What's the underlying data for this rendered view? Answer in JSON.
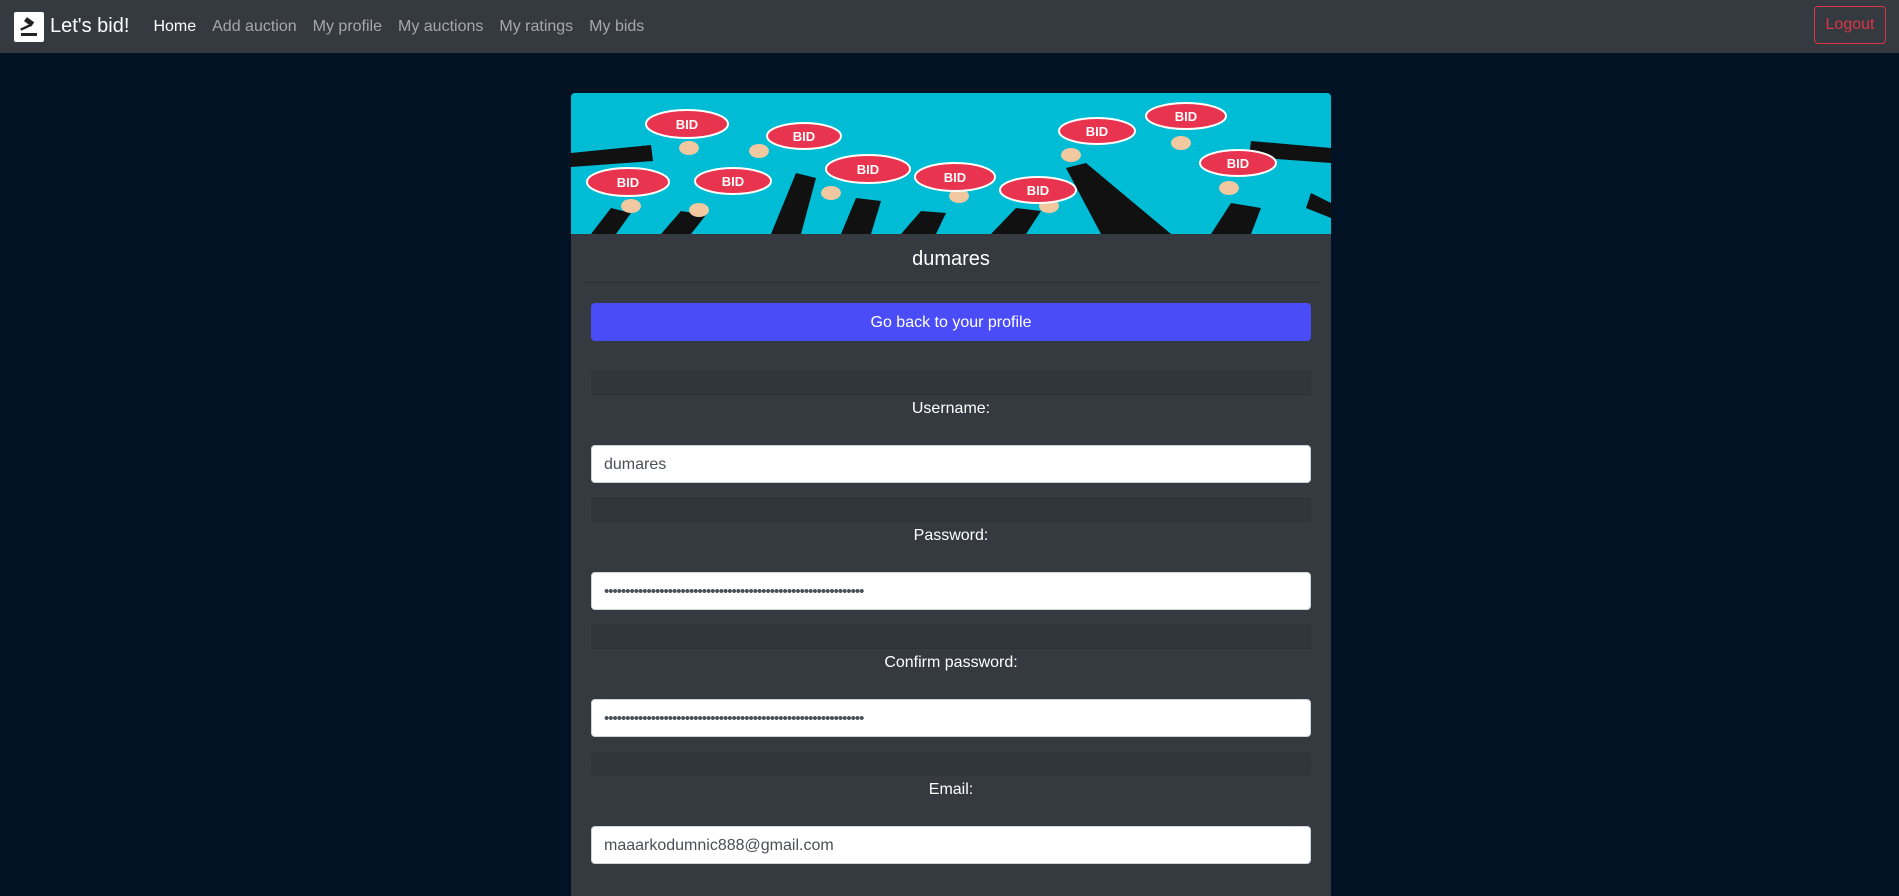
{
  "navbar": {
    "brand": "Let's bid!",
    "brand_icon": "gavel-icon",
    "links": [
      {
        "label": "Home",
        "active": true
      },
      {
        "label": "Add auction",
        "active": false
      },
      {
        "label": "My profile",
        "active": false
      },
      {
        "label": "My auctions",
        "active": false
      },
      {
        "label": "My ratings",
        "active": false
      },
      {
        "label": "My bids",
        "active": false
      }
    ],
    "logout_label": "Logout"
  },
  "card": {
    "title": "dumares",
    "banner": {
      "sign_text": "BID",
      "background_color": "#00bcd4",
      "sign_color": "#e8344e"
    },
    "back_button_label": "Go back to your profile",
    "fields": [
      {
        "label": "Username:",
        "value": "dumares"
      },
      {
        "label": "Password:",
        "value": "•••••••••••••••••••••••••••••••••••••••••••••••••••••••••••••"
      },
      {
        "label": "Confirm password:",
        "value": "•••••••••••••••••••••••••••••••••••••••••••••••••••••••••••••"
      },
      {
        "label": "Email:",
        "value": "maaarkodumnic888@gmail.com"
      }
    ]
  },
  "colors": {
    "page_background": "#021225",
    "navbar_background": "#353a41",
    "card_background": "#343a40",
    "primary_button": "#4a4cf8",
    "logout": "#dc3545"
  }
}
